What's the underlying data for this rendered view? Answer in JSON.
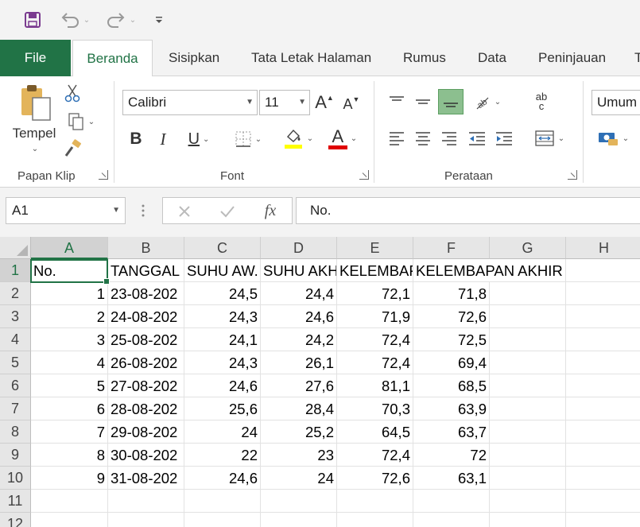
{
  "ribbon_tabs": [
    "File",
    "Beranda",
    "Sisipkan",
    "Tata Letak Halaman",
    "Rumus",
    "Data",
    "Peninjauan",
    "T"
  ],
  "clipboard": {
    "paste_label": "Tempel",
    "group_label": "Papan Klip"
  },
  "font": {
    "name": "Calibri",
    "size": "11",
    "grow": "A",
    "shrink": "A",
    "bold": "B",
    "italic": "I",
    "underline": "U",
    "font_color": "A",
    "group_label": "Font"
  },
  "alignment": {
    "wrap_label": "ab\nc",
    "group_label": "Perataan"
  },
  "number": {
    "format": "Umum"
  },
  "formula_bar": {
    "name_box": "A1",
    "fx": "fx",
    "content": "No."
  },
  "columns": [
    "A",
    "B",
    "C",
    "D",
    "E",
    "F",
    "G",
    "H"
  ],
  "rows": [
    "1",
    "2",
    "3",
    "4",
    "5",
    "6",
    "7",
    "8",
    "9",
    "10",
    "11",
    "12"
  ],
  "header_row": [
    "No.",
    "TANGGAL",
    "SUHU AW.",
    "SUHU AKH",
    "KELEMBAF",
    "KELEMBAPAN AKHIR"
  ],
  "data_rows": [
    [
      "1",
      "23-08-202",
      "24,5",
      "24,4",
      "72,1",
      "71,8"
    ],
    [
      "2",
      "24-08-202",
      "24,3",
      "24,6",
      "71,9",
      "72,6"
    ],
    [
      "3",
      "25-08-202",
      "24,1",
      "24,2",
      "72,4",
      "72,5"
    ],
    [
      "4",
      "26-08-202",
      "24,3",
      "26,1",
      "72,4",
      "69,4"
    ],
    [
      "5",
      "27-08-202",
      "24,6",
      "27,6",
      "81,1",
      "68,5"
    ],
    [
      "6",
      "28-08-202",
      "25,6",
      "28,4",
      "70,3",
      "63,9"
    ],
    [
      "7",
      "29-08-202",
      "24",
      "25,2",
      "64,5",
      "63,7"
    ],
    [
      "8",
      "30-08-202",
      "22",
      "23",
      "72,4",
      "72"
    ],
    [
      "9",
      "31-08-202",
      "24,6",
      "24",
      "72,6",
      "63,1"
    ]
  ],
  "colors": {
    "excel_green": "#217346",
    "highlight_yellow": "#ffff00",
    "font_red": "#e00000"
  }
}
